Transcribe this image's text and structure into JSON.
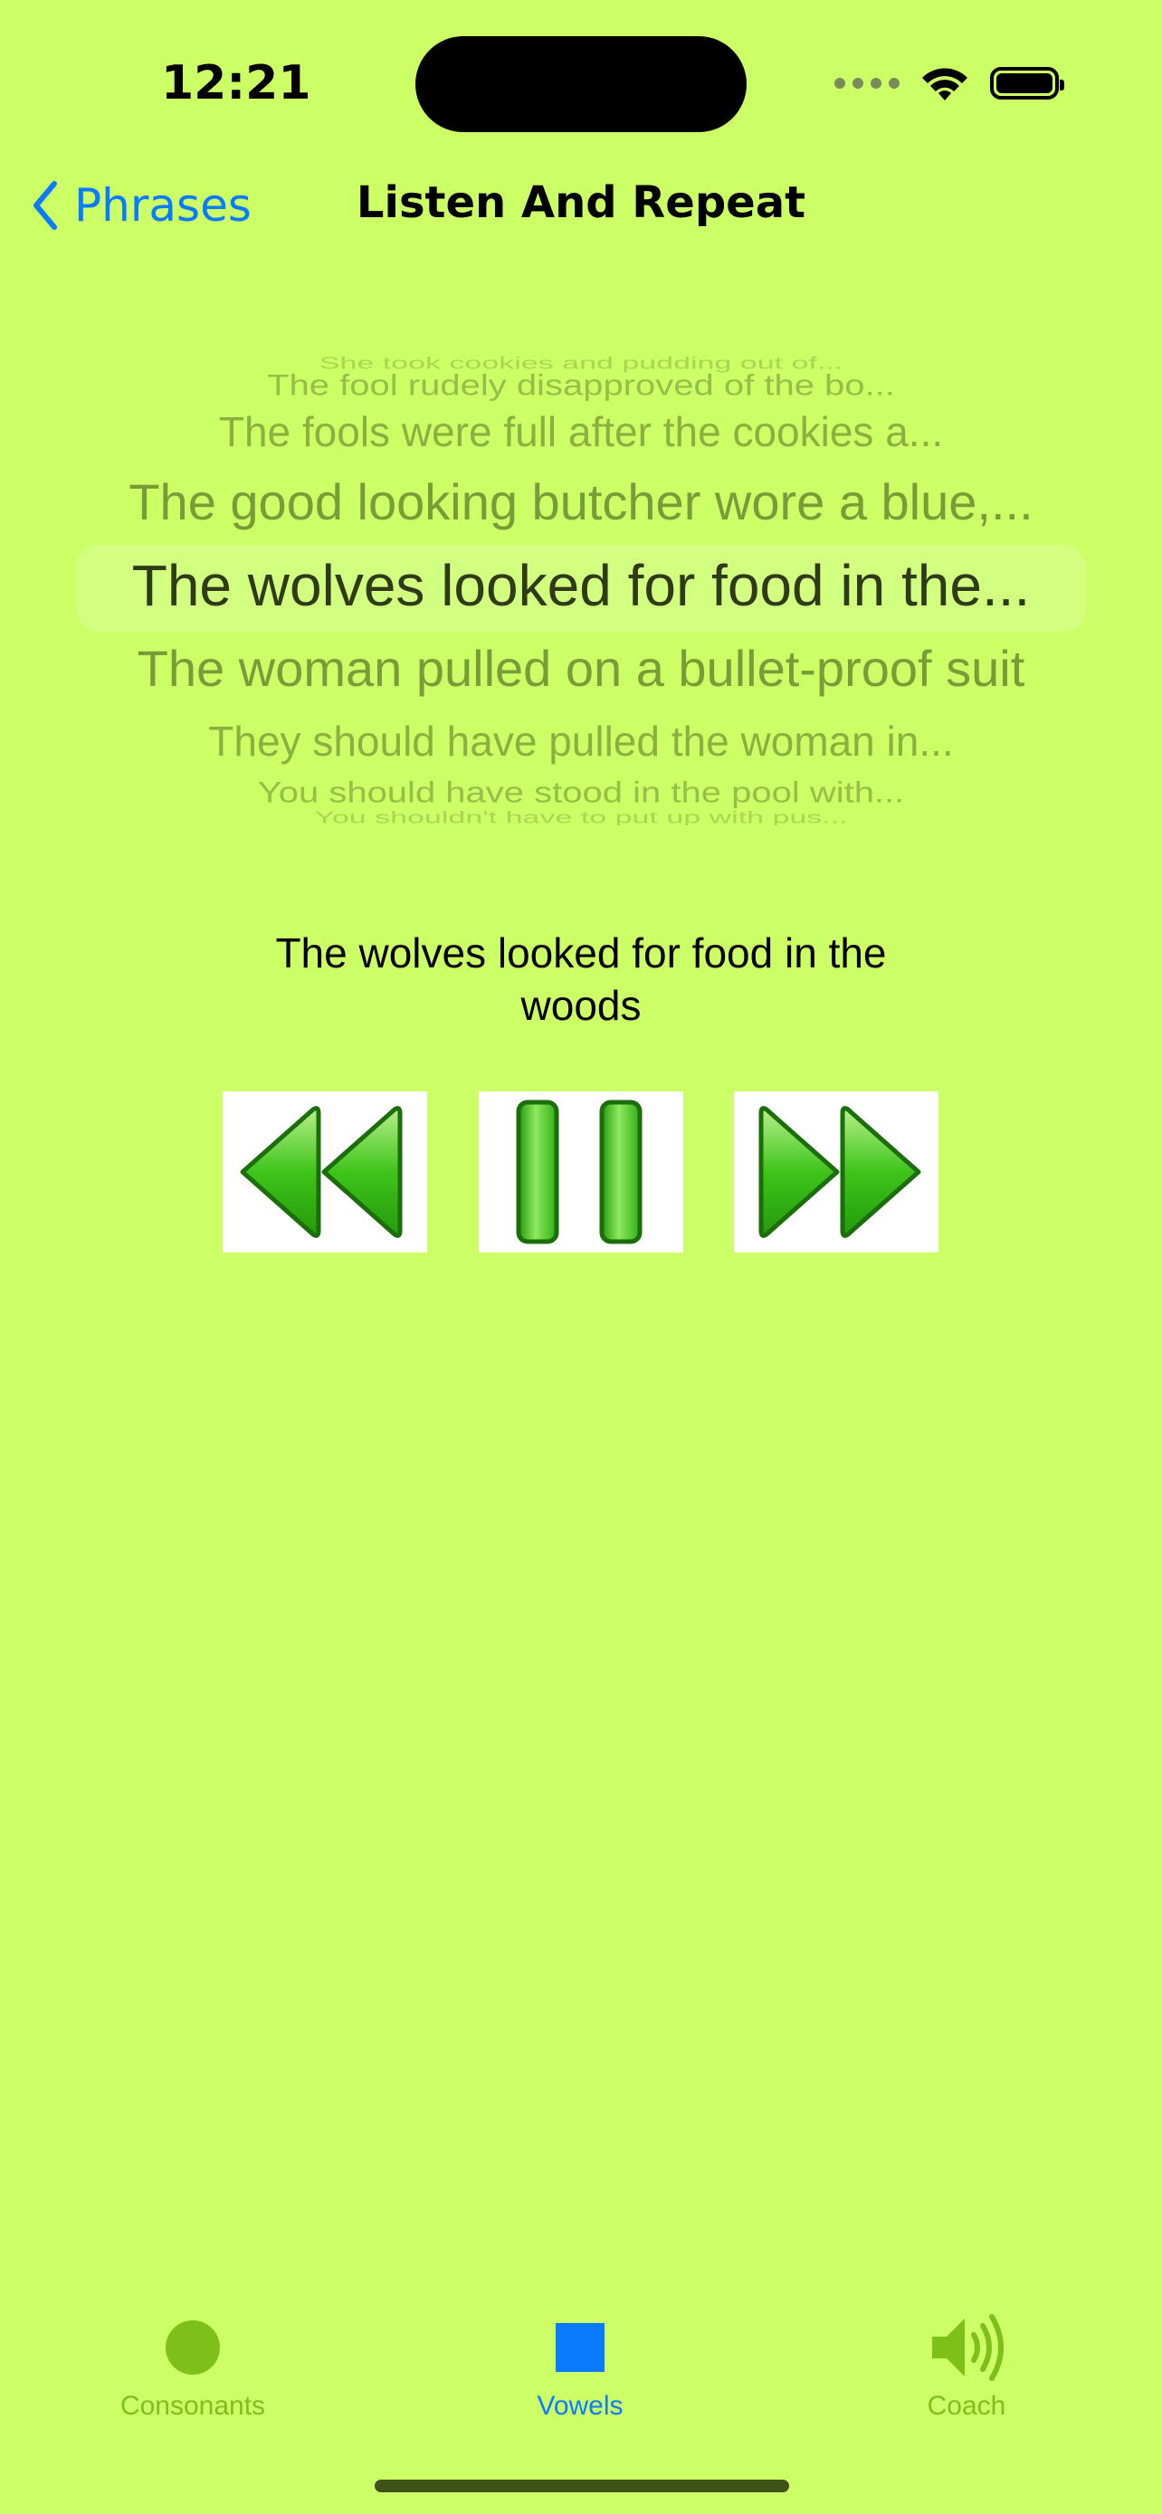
{
  "status_bar": {
    "time": "12:21"
  },
  "nav": {
    "back_label": "Phrases",
    "title": "Listen And Repeat"
  },
  "picker": {
    "rows": [
      "She took cookies and pudding out of...",
      "The fool rudely disapproved of the bo...",
      "The fools were full after the cookies a...",
      "The good looking butcher wore a blue,...",
      "The wolves looked for food in the...",
      "The woman pulled on a bullet-proof suit",
      "They should have pulled the woman in...",
      "You should have stood in the pool with...",
      "You shouldn't have to put up with pus..."
    ],
    "selected_index": 4
  },
  "current_phrase": "The wolves looked for food in the woods",
  "controls": {
    "colors": {
      "fill": "#3fc41a",
      "stroke": "#1b6e0a",
      "background": "#ffffff"
    },
    "icons": [
      "rewind-icon",
      "pause-icon",
      "fast-forward-icon"
    ]
  },
  "tab_bar": {
    "tabs": [
      {
        "label": "Consonants",
        "icon": "circle-icon",
        "color": "#7fbf1a",
        "selected": false
      },
      {
        "label": "Vowels",
        "icon": "square-icon",
        "color": "#0a7aff",
        "selected": true
      },
      {
        "label": "Coach",
        "icon": "speaker-icon",
        "color": "#7fbf1a",
        "selected": false
      }
    ]
  }
}
